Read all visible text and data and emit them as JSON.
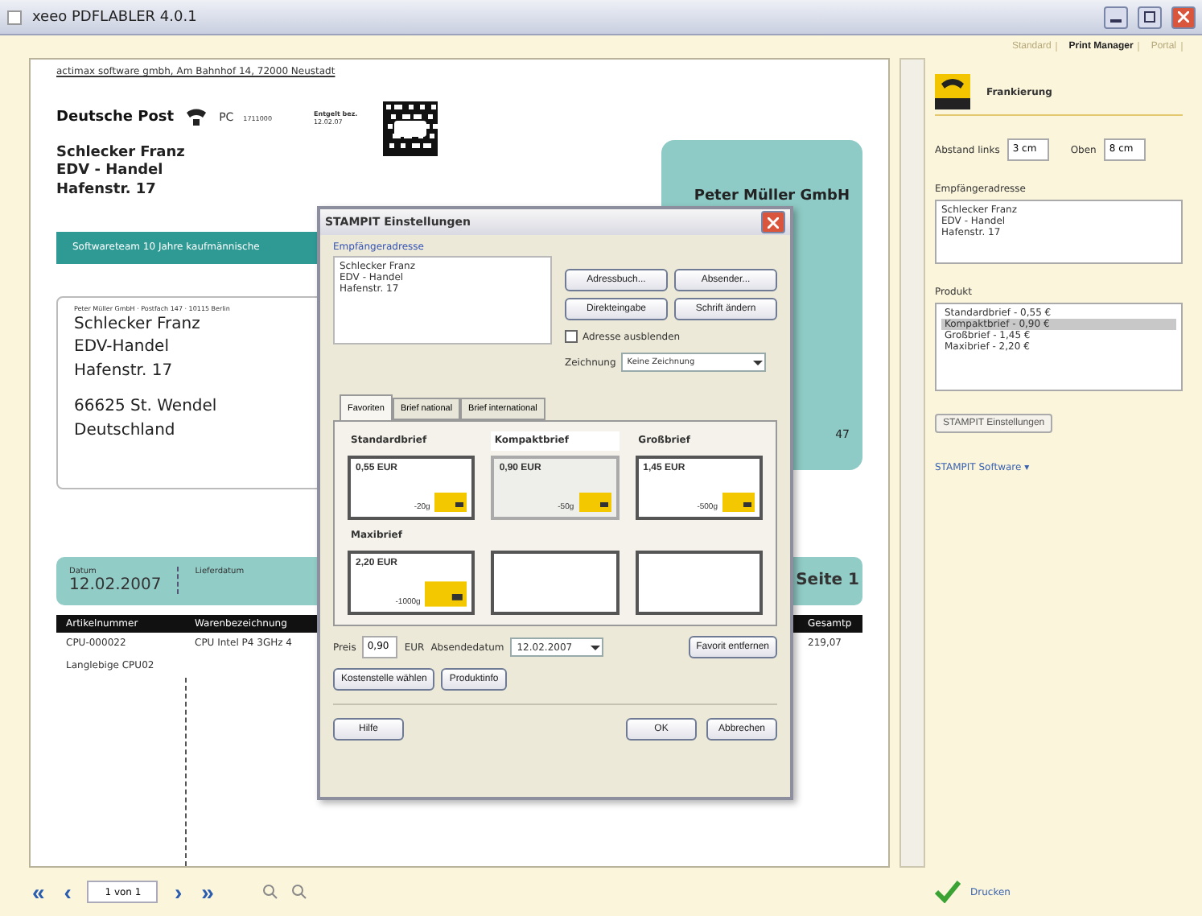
{
  "window": {
    "title": "xeeo PDFLABLER 4.0.1"
  },
  "view_tabs": [
    {
      "label": "Standard",
      "selected": false
    },
    {
      "label": "Print Manager",
      "selected": true
    },
    {
      "label": "Portal",
      "selected": false
    }
  ],
  "document": {
    "sender_line": "actimax software gmbh, Am Bahnhof 14, 72000 Neustadt",
    "postage_brand": "Deutsche Post",
    "postage_code": "PC",
    "postage_number": "1711000",
    "postage_date_label": "Entgelt bez.",
    "postage_date": "12.02.07",
    "recipient": [
      "Schlecker Franz",
      "EDV - Handel",
      "Hafenstr. 17"
    ],
    "banner": "Softwareteam 10 Jahre kaufmännische",
    "window_sender": "Peter Müller GmbH · Postfach 147 · 10115 Berlin",
    "window_address": [
      "Schlecker Franz",
      "EDV-Handel",
      "Hafenstr. 17"
    ],
    "window_city": [
      "66625 St. Wendel",
      "Deutschland"
    ],
    "company": "Peter Müller GmbH",
    "company_tail": "47",
    "date_label": "Datum",
    "date": "12.02.2007",
    "delivery_label": "Lieferdatum",
    "page": "Seite 1",
    "columns": [
      "Artikelnummer",
      "Warenbezeichnung",
      "Gesamtp"
    ],
    "rows": [
      [
        "CPU-000022",
        "CPU Intel P4 3GHz 4",
        "219,07"
      ],
      [
        "Langlebige CPU02",
        "",
        ""
      ]
    ]
  },
  "pager": {
    "first": "«",
    "prev": "‹",
    "page": "1 von 1",
    "next": "›",
    "last": "»"
  },
  "panel": {
    "title": "Frankierung",
    "left_label": "Abstand links",
    "left": "3 cm",
    "top_label": "Oben",
    "top": "8 cm",
    "address_label": "Empfängeradresse",
    "address": [
      "Schlecker Franz",
      "EDV - Handel",
      "Hafenstr. 17"
    ],
    "product_label": "Produkt",
    "products": [
      {
        "label": "Standardbrief - 0,55 €",
        "selected": false
      },
      {
        "label": "Kompaktbrief - 0,90 €",
        "selected": true
      },
      {
        "label": "Großbrief - 1,45 €",
        "selected": false
      },
      {
        "label": "Maxibrief - 2,20 €",
        "selected": false
      }
    ],
    "settings_button": "STAMPIT Einstellungen",
    "software_link": "STAMPIT Software ▾",
    "print": "Drucken"
  },
  "dialog": {
    "title": "STAMPIT Einstellungen",
    "group": "Empfängeradresse",
    "address": [
      "Schlecker Franz",
      "EDV - Handel",
      "Hafenstr. 17"
    ],
    "buttons": [
      "Adressbuch...",
      "Absender...",
      "Direkteingabe",
      "Schrift ändern"
    ],
    "hide_address": {
      "label": "Adresse ausblenden",
      "checked": false
    },
    "drawing_label": "Zeichnung",
    "drawing": "Keine Zeichnung",
    "tabs": [
      {
        "label": "Favoriten",
        "selected": true
      },
      {
        "label": "Brief national",
        "selected": false
      },
      {
        "label": "Brief international",
        "selected": false
      }
    ],
    "stamps": [
      {
        "kind": "product",
        "name": "Standardbrief",
        "price": "0,55 EUR",
        "weight": "-20g",
        "selected": false
      },
      {
        "kind": "product",
        "name": "Kompaktbrief",
        "price": "0,90 EUR",
        "weight": "-50g",
        "selected": true
      },
      {
        "kind": "product",
        "name": "Großbrief",
        "price": "1,45 EUR",
        "weight": "-500g",
        "selected": false
      },
      {
        "kind": "product",
        "name": "Maxibrief",
        "price": "2,20 EUR",
        "weight": "-1000g",
        "selected": false
      },
      {
        "kind": "empty"
      },
      {
        "kind": "empty"
      }
    ],
    "price_label": "Preis",
    "price": "0,90",
    "currency": "EUR",
    "date_label": "Absendedatum",
    "date": "12.02.2007",
    "remove": "Favorit entfernen",
    "cost_center": "Kostenstelle wählen",
    "info": "Produktinfo",
    "help": "Hilfe",
    "ok": "OK",
    "cancel": "Abbrechen"
  }
}
